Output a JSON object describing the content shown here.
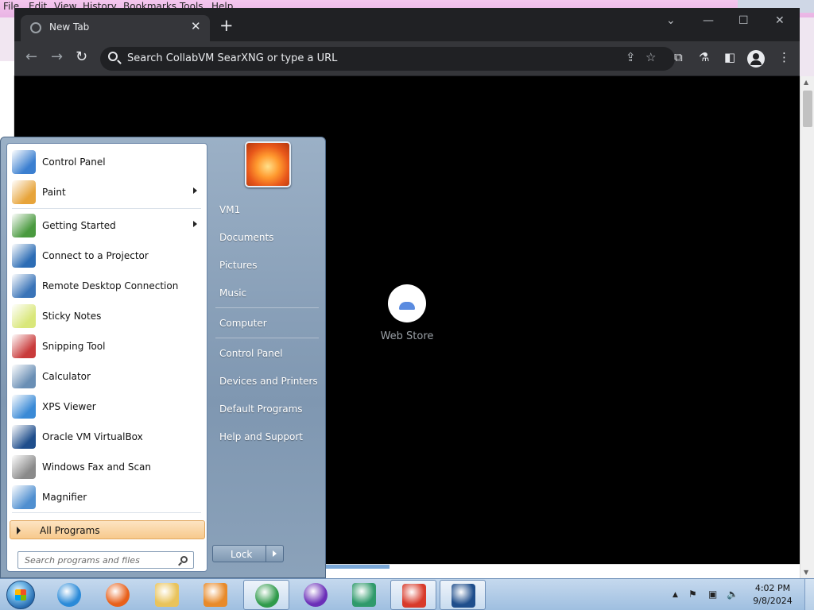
{
  "firefox": {
    "menu": [
      "File",
      "Edit",
      "View",
      "History",
      "Bookmarks",
      "Tools",
      "Help"
    ]
  },
  "chrome": {
    "tab_title": "New Tab",
    "new_tab_label": "+",
    "address_placeholder": "Search CollabVM SearXNG or type a URL",
    "shortcut_label": "Web Store",
    "close_tab_glyph": "✕",
    "back_glyph": "←",
    "forward_glyph": "→",
    "reload_glyph": "↻",
    "dropdown_glyph": "⌄",
    "minimize_glyph": "—",
    "maximize_glyph": "☐",
    "close_glyph": "✕",
    "share_glyph": "⇪",
    "star_glyph": "☆",
    "extensions_glyph": "⧉",
    "labs_glyph": "⚗",
    "sidepanel_glyph": "◧",
    "menu_glyph": "⋮"
  },
  "start_menu": {
    "programs": [
      {
        "label": "Control Panel",
        "icon": "control-panel-icon",
        "color": "#3b7fd0"
      },
      {
        "label": "Paint",
        "icon": "paint-icon",
        "color": "#e7a43a",
        "submenu": true
      },
      {
        "label": "Getting Started",
        "icon": "getting-started-icon",
        "color": "#4a9a3f",
        "submenu": true
      },
      {
        "label": "Connect to a Projector",
        "icon": "projector-icon",
        "color": "#2d6db5"
      },
      {
        "label": "Remote Desktop Connection",
        "icon": "remote-desktop-icon",
        "color": "#3a74b8"
      },
      {
        "label": "Sticky Notes",
        "icon": "sticky-notes-icon",
        "color": "#d9e77a"
      },
      {
        "label": "Snipping Tool",
        "icon": "snipping-tool-icon",
        "color": "#c93b3b"
      },
      {
        "label": "Calculator",
        "icon": "calculator-icon",
        "color": "#6a8fb5"
      },
      {
        "label": "XPS Viewer",
        "icon": "xps-viewer-icon",
        "color": "#3a8ad6"
      },
      {
        "label": "Oracle VM VirtualBox",
        "icon": "virtualbox-icon",
        "color": "#1f4e8c"
      },
      {
        "label": "Windows Fax and Scan",
        "icon": "fax-scan-icon",
        "color": "#8a8a8a"
      },
      {
        "label": "Magnifier",
        "icon": "magnifier-icon",
        "color": "#4f8fd0"
      }
    ],
    "all_programs": "All Programs",
    "search_placeholder": "Search programs and files",
    "right_items": [
      {
        "label": "VM1"
      },
      {
        "label": "Documents"
      },
      {
        "label": "Pictures"
      },
      {
        "label": "Music"
      },
      {
        "label": "Computer"
      },
      {
        "label": "Control Panel"
      },
      {
        "label": "Devices and Printers"
      },
      {
        "label": "Default Programs"
      },
      {
        "label": "Help and Support"
      }
    ],
    "lock_label": "Lock"
  },
  "taskbar": {
    "pinned": [
      {
        "name": "internet-explorer-icon",
        "color": "#2a8ad8"
      },
      {
        "name": "firefox-icon",
        "color": "#e8601a"
      },
      {
        "name": "explorer-folder-icon",
        "color": "#e9c35b"
      },
      {
        "name": "media-player-icon",
        "color": "#e88a2a"
      },
      {
        "name": "chrome-icon",
        "color": "#2f9a4a"
      },
      {
        "name": "purple-app-icon",
        "color": "#6b2fb8"
      },
      {
        "name": "dragon-app-icon",
        "color": "#2f9a6b"
      },
      {
        "name": "red-app-icon",
        "color": "#d83a2a"
      },
      {
        "name": "virtualbox-taskbar-icon",
        "color": "#1f4e8c"
      }
    ],
    "tray_chevron": "▲",
    "tray_flag": "⚑",
    "tray_network": "▣",
    "tray_volume": "🔈",
    "time": "4:02 PM",
    "date": "9/8/2024"
  }
}
